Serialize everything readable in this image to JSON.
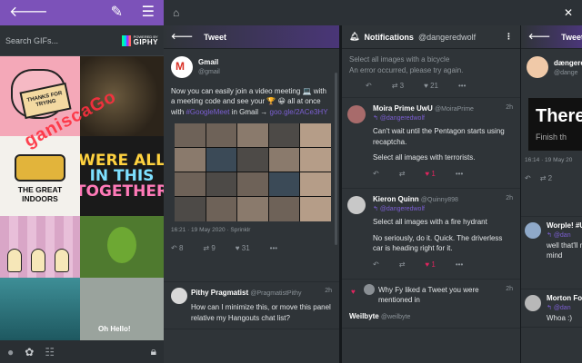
{
  "gif_panel": {
    "search_placeholder": "Search GIFs...",
    "giphy_powered": "POWERED BY",
    "giphy_name": "GIPHY",
    "gif1_caption": "THANKS FOR TRYING",
    "gif3_caption": "THE GREAT INDOORS",
    "gif4_lines": [
      "WERE ALL",
      "IN THIS",
      "TOGETHER"
    ],
    "gif8_caption": "Oh Hello!",
    "watermark": "ganiscaGo"
  },
  "col1": {
    "title": "Tweet",
    "tweet": {
      "name": "Gmail",
      "handle": "@gmail",
      "text_before": "Now you can easily join a video meeting 💻 with a meeting code and see your 🏆 😀 all at once with ",
      "hashtag": "#GoogleMeet",
      "text_mid": " in Gmail → ",
      "url": "goo.gle/2ACe3HY",
      "timestamp": "16:21 · 19 May 2020 · Sprinklr",
      "replies": "8",
      "retweets": "9",
      "likes": "31"
    },
    "tweet2": {
      "name": "Pithy Pragmatist",
      "handle": "@PragmatistPithy",
      "time": "2h",
      "text": "How can I minimize this, or move this panel relative my Hangouts chat list?"
    }
  },
  "col2": {
    "title": "Notifications",
    "account": "@dangeredwolf",
    "top_text1": "Select all images with a bicycle",
    "top_text2": "An error occurred, please try again.",
    "top_retweets": "3",
    "top_likes": "21",
    "n1": {
      "name": "Moira Prime UwU",
      "handle": "@MoiraPrime",
      "time": "2h",
      "reply_to": "@dangeredwolf",
      "text1": "Can't wait until the Pentagon starts using recaptcha.",
      "text2": "Select all images with terrorists.",
      "likes": "1"
    },
    "n2": {
      "name": "Kieron Quinn",
      "handle": "@Quinny898",
      "time": "2h",
      "reply_to": "@dangeredwolf",
      "text1": "Select all images with a fire hydrant",
      "text2": "No seriously, do it. Quick. The driverless car is heading right for it.",
      "likes": "1"
    },
    "n3": {
      "text": "Why Fy liked a Tweet you were mentioned in",
      "time": "2h",
      "name": "Weilbyte",
      "handle": "@weilbyte"
    }
  },
  "col3": {
    "title": "Tweet",
    "name": "dængere",
    "handle": "@dange",
    "image_text": "There",
    "image_sub": "Finish th",
    "timestamp": "16:14 · 19 May 20",
    "count": "2",
    "r1_name": "Worple! #U",
    "r1_text": "well that'll m mind",
    "r2_name": "Morton Fox",
    "r2_text": "Whoa :)",
    "reply_to": "@dan"
  }
}
